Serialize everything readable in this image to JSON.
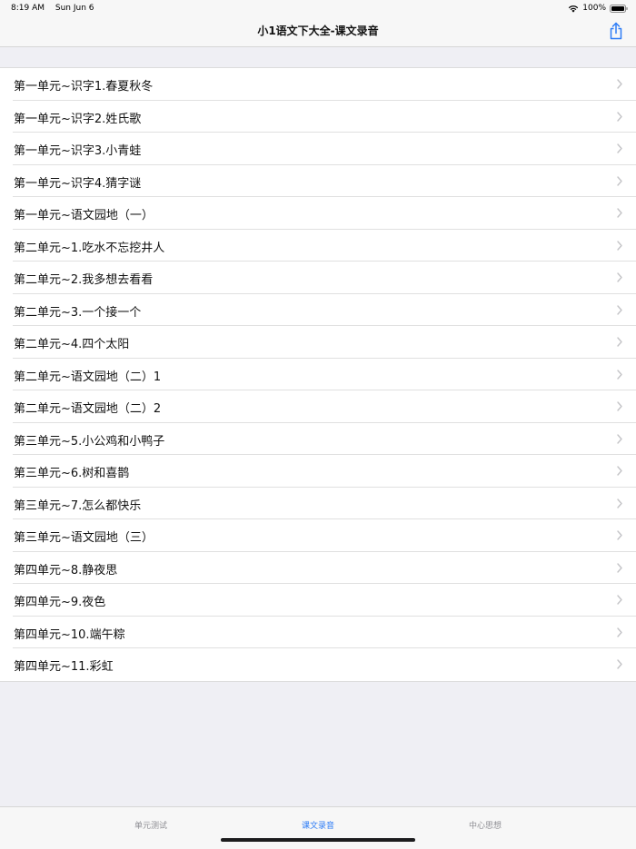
{
  "status_bar": {
    "time": "8:19 AM",
    "date": "Sun Jun 6",
    "battery": "100%"
  },
  "nav": {
    "title": "小1语文下大全-课文录音"
  },
  "icons": {
    "share": "share-icon",
    "chevron": "chevron-right-icon",
    "wifi": "wifi-icon",
    "battery": "battery-icon"
  },
  "colors": {
    "accent": "#2d7cf6",
    "tab_inactive": "#8e8e93",
    "background": "#efeff4"
  },
  "lessons": [
    "第一单元~识字1.春夏秋冬",
    "第一单元~识字2.姓氏歌",
    "第一单元~识字3.小青蛙",
    "第一单元~识字4.猜字谜",
    "第一单元~语文园地（一）",
    "第二单元~1.吃水不忘挖井人",
    "第二单元~2.我多想去看看",
    "第二单元~3.一个接一个",
    "第二单元~4.四个太阳",
    "第二单元~语文园地（二）1",
    "第二单元~语文园地（二）2",
    "第三单元~5.小公鸡和小鸭子",
    "第三单元~6.树和喜鹊",
    "第三单元~7.怎么都快乐",
    "第三单元~语文园地（三）",
    "第四单元~8.静夜思",
    "第四单元~9.夜色",
    "第四单元~10.端午粽",
    "第四单元~11.彩虹"
  ],
  "tabs": [
    {
      "label": "单元测试",
      "active": false
    },
    {
      "label": "课文录音",
      "active": true
    },
    {
      "label": "中心思想",
      "active": false
    }
  ]
}
